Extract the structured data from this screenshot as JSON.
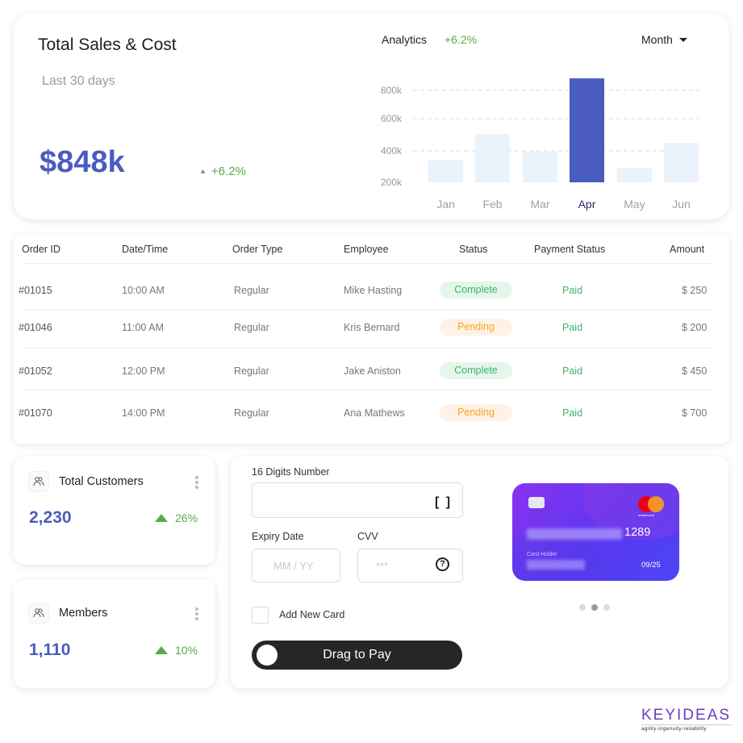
{
  "sales": {
    "title": "Total Sales & Cost",
    "subtitle": "Last 30 days",
    "value": "$848k",
    "change": "+6.2%",
    "change_icon": "triangle-up-icon"
  },
  "analytics": {
    "label": "Analytics",
    "change": "+6.2%",
    "period_selected": "Month"
  },
  "chart_data": {
    "type": "bar",
    "title": "Analytics",
    "categories": [
      "Jan",
      "Feb",
      "Mar",
      "Apr",
      "May",
      "Jun"
    ],
    "values": [
      340000,
      505000,
      395000,
      885000,
      290000,
      450000
    ],
    "highlighted": "Apr",
    "y_ticks": [
      "200k",
      "400k",
      "600k",
      "800k"
    ],
    "y_tick_values": [
      200000,
      400000,
      600000,
      800000
    ],
    "ylim": [
      200000,
      900000
    ],
    "xlabel": "",
    "ylabel": "",
    "grid": "dashed horizontal",
    "colors": {
      "bar": "#eaf3fc",
      "highlight": "#4a5cbf",
      "highlight_label": "#2d2a6e"
    }
  },
  "orders": {
    "headers": [
      "Order ID",
      "Date/Time",
      "Order Type",
      "Employee",
      "Status",
      "Payment Status",
      "Amount"
    ],
    "rows": [
      {
        "id": "#01015",
        "time": "10:00 AM",
        "type": "Regular",
        "employee": "Mike Hasting",
        "status": "Complete",
        "payment": "Paid",
        "amount": "$ 250"
      },
      {
        "id": "#01046",
        "time": "11:00 AM",
        "type": "Regular",
        "employee": "Kris Bernard",
        "status": "Pending",
        "payment": "Paid",
        "amount": "$ 200"
      },
      {
        "id": "#01052",
        "time": "12:00 PM",
        "type": "Regular",
        "employee": "Jake Aniston",
        "status": "Complete",
        "payment": "Paid",
        "amount": "$ 450"
      },
      {
        "id": "#01070",
        "time": "14:00 PM",
        "type": "Regular",
        "employee": "Ana Mathews",
        "status": "Pending",
        "payment": "Paid",
        "amount": "$ 700"
      }
    ]
  },
  "stats": [
    {
      "label": "Total Customers",
      "value": "2,230",
      "change": "26%",
      "icon": "users-icon"
    },
    {
      "label": "Members",
      "value": "1,110",
      "change": "10%",
      "icon": "users-icon"
    }
  ],
  "payment": {
    "card_number_label": "16 Digits Number",
    "card_number_value": "",
    "expiry_label": "Expiry Date",
    "expiry_placeholder": "MM / YY",
    "cvv_label": "CVV",
    "cvv_placeholder": "***",
    "add_card_label": "Add New Card",
    "add_card_checked": false,
    "drag_label": "Drag to Pay",
    "scan_icon": "[ ]",
    "help_icon": "?"
  },
  "credit_card": {
    "brand": "mastercard",
    "last_digits": "1289",
    "holder_label": "Card Holder",
    "expiry": "09/25",
    "carousel_active_index": 1,
    "carousel_count": 3
  },
  "branding": {
    "logo": "KEYIDEAS",
    "tagline": "agility-ingenuity-reliability",
    "logo_color": "#6a3dbd"
  }
}
